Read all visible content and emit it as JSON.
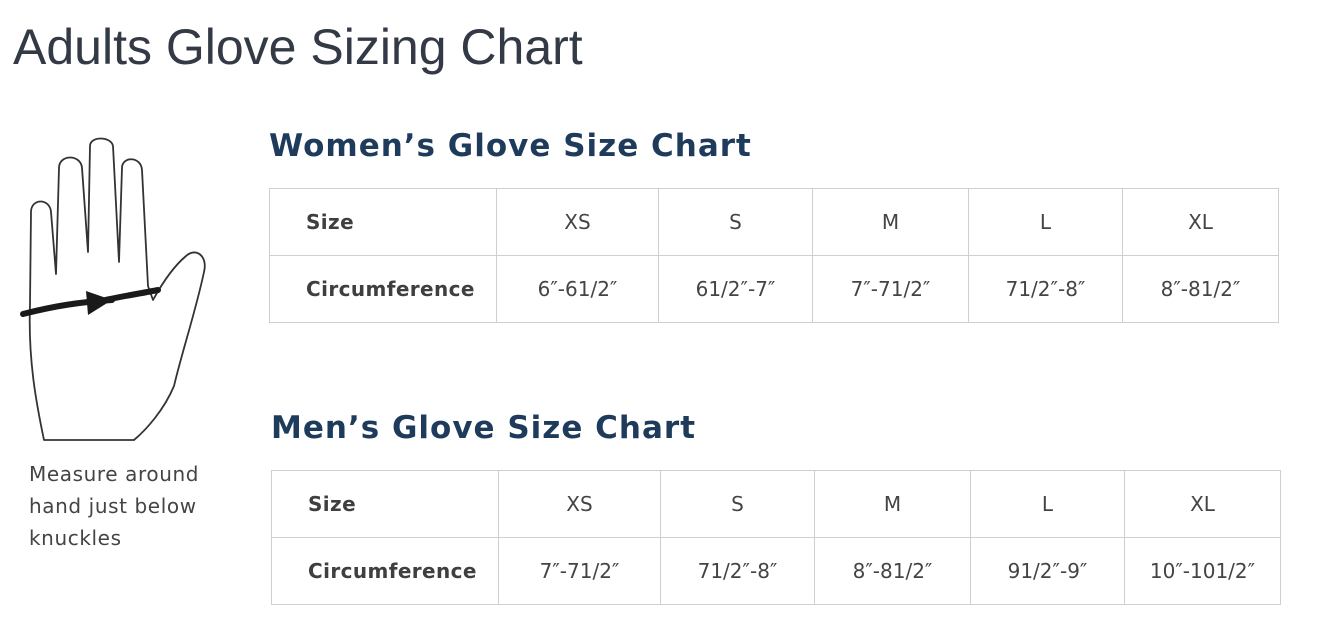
{
  "page_title": "Adults Glove Sizing Chart",
  "measure_caption": "Measure around hand just below knuckles",
  "hand_icon": "hand-measure-icon",
  "women": {
    "title": "Women’s Glove Size Chart",
    "size_label": "Size",
    "circumference_label": "Circumference",
    "sizes": [
      "XS",
      "S",
      "M",
      "L",
      "XL"
    ],
    "circumferences": [
      "6″-61/2″",
      "61/2″-7″",
      "7″-71/2″",
      "71/2″-8″",
      "8″-81/2″"
    ]
  },
  "men": {
    "title": "Men’s Glove Size Chart",
    "size_label": "Size",
    "circumference_label": "Circumference",
    "sizes": [
      "XS",
      "S",
      "M",
      "L",
      "XL"
    ],
    "circumferences": [
      "7″-71/2″",
      "71/2″-8″",
      "8″-81/2″",
      "91/2″-9″",
      "10″-101/2″"
    ]
  },
  "colors": {
    "title": "#333a45",
    "section_title": "#1f3b5c",
    "table_border": "#cfcfcf",
    "text": "#444444"
  }
}
